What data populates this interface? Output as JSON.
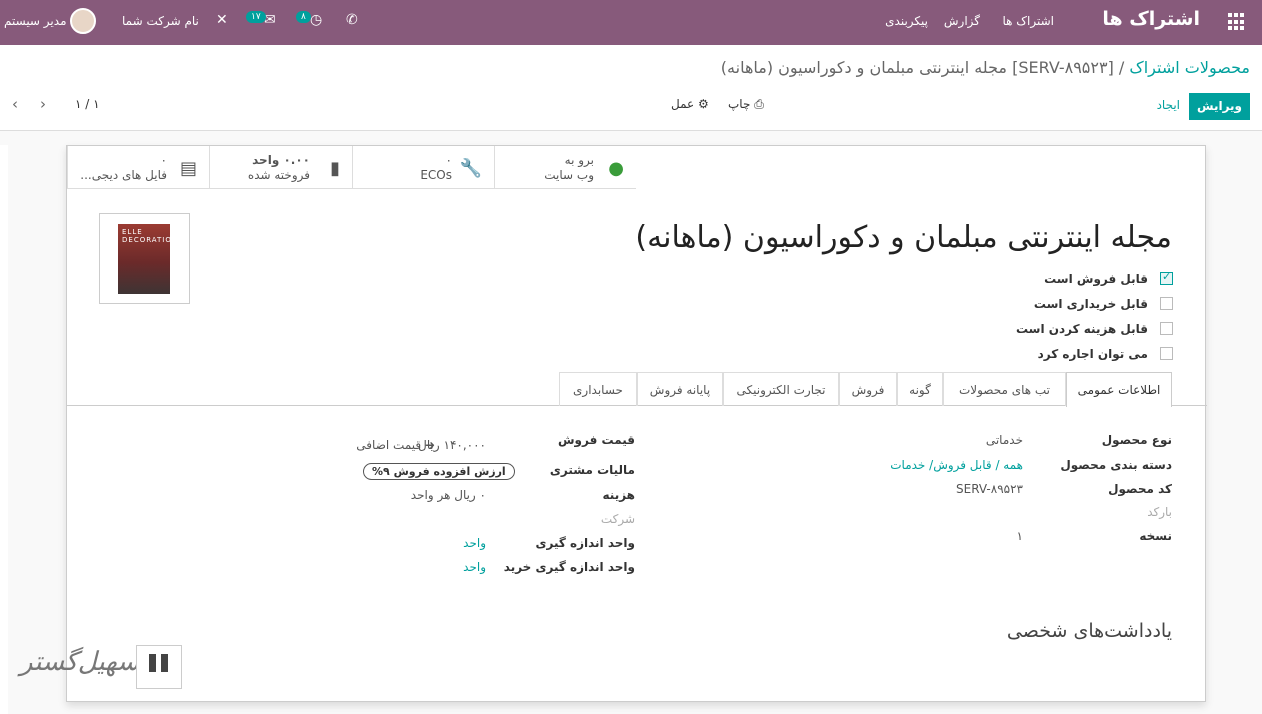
{
  "nav": {
    "brand": "اشتراک ها",
    "menu": [
      "اشتراک ها",
      "گزارش",
      "پیکربندی"
    ],
    "badge_activity": "۸",
    "badge_messages": "۱۷",
    "company": "نام شرکت شما",
    "user": "مدیر سیستم"
  },
  "control": {
    "breadcrumb_parent": "محصولات اشتراک",
    "breadcrumb_sep": " / ",
    "breadcrumb_current": "[SERV-۸۹۵۲۳] مجله اینترنتی مبلمان و دکوراسیون (ماهانه)",
    "edit": "ویرایش",
    "create": "ایجاد",
    "print": "چاپ",
    "action": "عمل",
    "pager": "۱ / ۱"
  },
  "smart_buttons": [
    {
      "value": "برو به",
      "label": "وب سایت",
      "icon": "globe-icon"
    },
    {
      "value": "۰",
      "label": "ECOs",
      "icon": "wrench-icon"
    },
    {
      "value": "۰.۰۰ واحد",
      "label": "فروخته شده",
      "icon": "bar-chart-icon"
    },
    {
      "value": "۰",
      "label": "فایل های دیجی...",
      "icon": "file-icon"
    }
  ],
  "product": {
    "title": "مجله اینترنتی مبلمان و دکوراسیون (ماهانه)",
    "cover_text": "ELLE DECORATION"
  },
  "checkboxes": [
    {
      "label": "قابل فروش است",
      "checked": true
    },
    {
      "label": "قابل خریداری است",
      "checked": false
    },
    {
      "label": "قابل هزینه کردن است",
      "checked": false
    },
    {
      "label": "می توان اجاره کرد",
      "checked": false
    }
  ],
  "tabs": [
    "اطلاعات عمومی",
    "تب های محصولات",
    "گونه",
    "فروش",
    "تجارت الکترونیکی",
    "پایانه فروش",
    "حسابداری"
  ],
  "general": {
    "product_type_label": "نوع محصول",
    "product_type": "خدماتی",
    "category_label": "دسته بندی محصول",
    "category": "همه / قابل فروش/ خدمات",
    "code_label": "کد محصول",
    "code": "SERV-۸۹۵۲۳",
    "barcode_label": "بارکد",
    "version_label": "نسخه",
    "version": "۱",
    "sale_price_label": "قیمت فروش",
    "sale_price": "۱۴۰,۰۰۰ ریال",
    "extra_price": "قیمت اضافی",
    "customer_tax_label": "مالیات مشتری",
    "customer_tax": "ارزش افزوده فروش ۹%",
    "cost_label": "هزینه",
    "cost": "۰ ریال هر واحد",
    "company_placeholder": "شرکت",
    "uom_label": "واحد اندازه گیری",
    "uom": "واحد",
    "purchase_uom_label": "واحد اندازه گیری خرید",
    "purchase_uom": "واحد"
  },
  "notes_title": "یادداشت‌های شخصی",
  "watermark": "تسهیل‌گستر",
  "colors": {
    "primary": "#875a7b",
    "accent": "#00a09d"
  }
}
